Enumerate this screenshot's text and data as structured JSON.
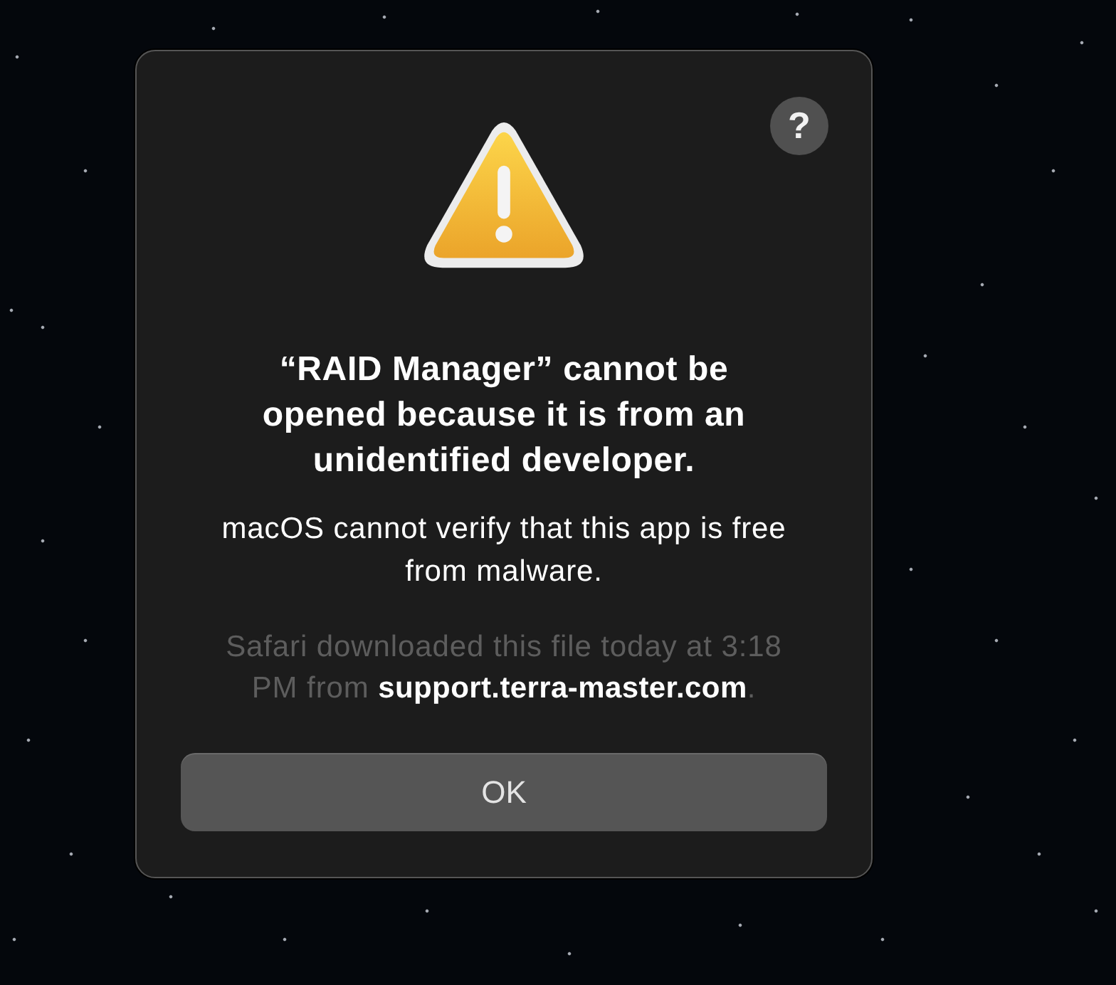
{
  "dialog": {
    "help_button": {
      "label": "?"
    },
    "title": "“RAID Manager” cannot be opened because it is from an unidentified developer.",
    "message": "macOS cannot verify that this app is free from malware.",
    "source_note": "Safari downloaded this file today at 3:18 PM from **support.terra-master.com**.",
    "buttons": [
      {
        "label": "OK"
      }
    ]
  }
}
